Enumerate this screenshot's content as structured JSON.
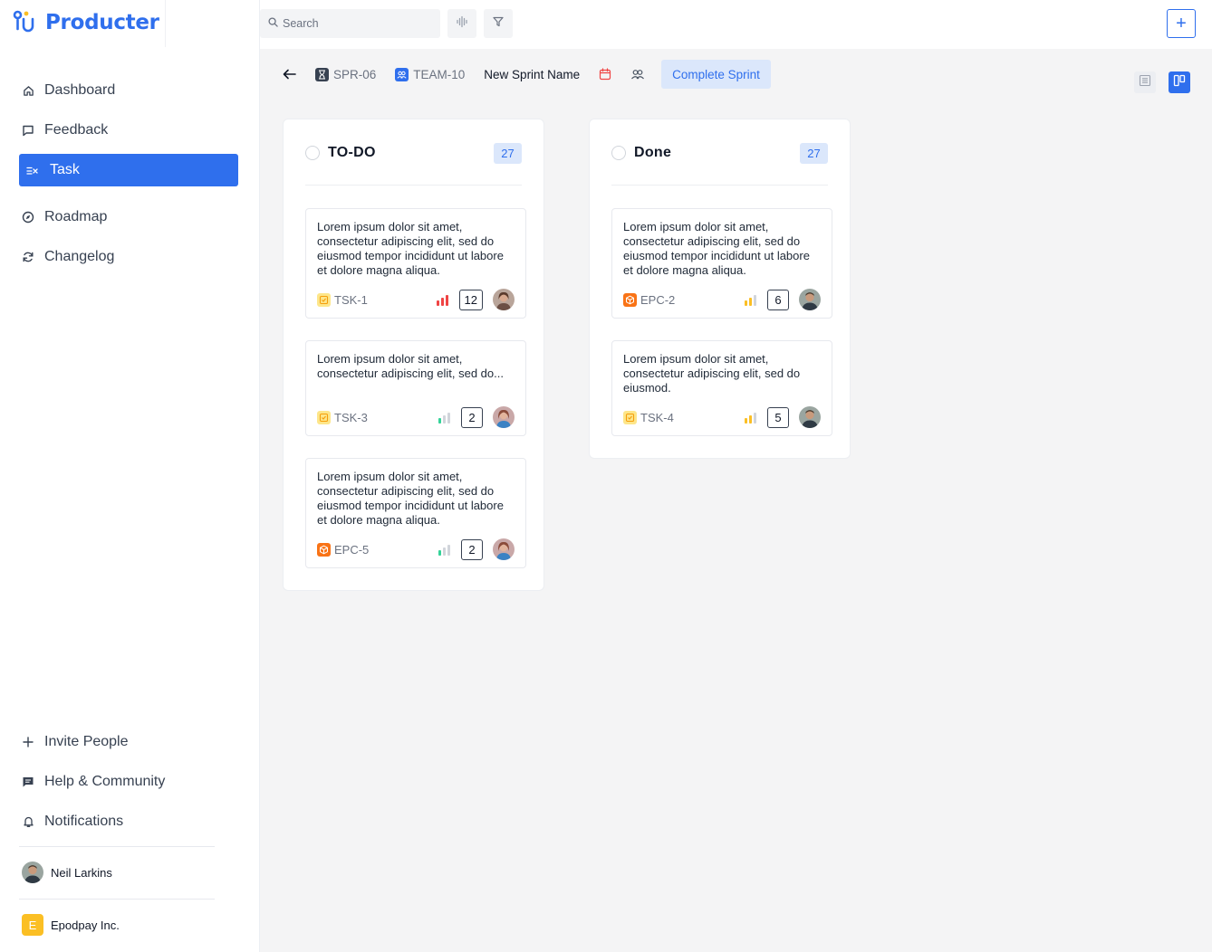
{
  "app": {
    "name": "Producter"
  },
  "sidebar": {
    "items": [
      {
        "label": "Dashboard",
        "icon": "home-icon",
        "active": false
      },
      {
        "label": "Feedback",
        "icon": "message-square-icon",
        "active": false
      },
      {
        "label": "Task",
        "icon": "task-list-icon",
        "active": true
      },
      {
        "label": "Roadmap",
        "icon": "compass-icon",
        "active": false
      },
      {
        "label": "Changelog",
        "icon": "refresh-icon",
        "active": false
      }
    ],
    "bottom_items": [
      {
        "label": "Invite People",
        "icon": "plus-icon"
      },
      {
        "label": "Help & Community",
        "icon": "chat-icon"
      },
      {
        "label": "Notifications",
        "icon": "bell-icon"
      }
    ],
    "user": {
      "name": "Neil Larkins"
    },
    "org": {
      "name": "Epodpay Inc.",
      "initial": "E"
    }
  },
  "topbar": {
    "search_placeholder": "Search",
    "add_button": "+"
  },
  "sprint": {
    "sprint_id": "SPR-06",
    "team_id": "TEAM-10",
    "name": "New Sprint Name",
    "complete_label": "Complete Sprint"
  },
  "columns": [
    {
      "title": "TO-DO",
      "count": "27",
      "cards": [
        {
          "text": "Lorem ipsum dolor sit amet, consectetur adipiscing elit, sed do eiusmod tempor incididunt ut labore et dolore magna aliqua.",
          "id": "TSK-1",
          "type": "task",
          "priority": "high",
          "points": "12"
        },
        {
          "text": "Lorem ipsum dolor sit amet, consectetur adipiscing elit, sed do...",
          "id": "TSK-3",
          "type": "task",
          "priority": "low",
          "points": "2"
        },
        {
          "text": "Lorem ipsum dolor sit amet, consectetur adipiscing elit, sed do eiusmod tempor incididunt ut labore et dolore magna aliqua.",
          "id": "EPC-5",
          "type": "epic",
          "priority": "low",
          "points": "2"
        }
      ]
    },
    {
      "title": "Done",
      "count": "27",
      "cards": [
        {
          "text": "Lorem ipsum dolor sit amet, consectetur adipiscing elit, sed do eiusmod tempor incididunt ut labore et dolore magna aliqua.",
          "id": "EPC-2",
          "type": "epic",
          "priority": "medium",
          "points": "6"
        },
        {
          "text": "Lorem ipsum dolor sit amet, consectetur adipiscing elit, sed do eiusmod.",
          "id": "TSK-4",
          "type": "task",
          "priority": "medium",
          "points": "5"
        }
      ]
    }
  ],
  "colors": {
    "accent": "#2f6fed",
    "priority_high": "#ef4444",
    "priority_medium": "#fbbf24",
    "priority_low": "#34d399",
    "task_tag": "#fcd34d",
    "epic_tag": "#f97316"
  }
}
